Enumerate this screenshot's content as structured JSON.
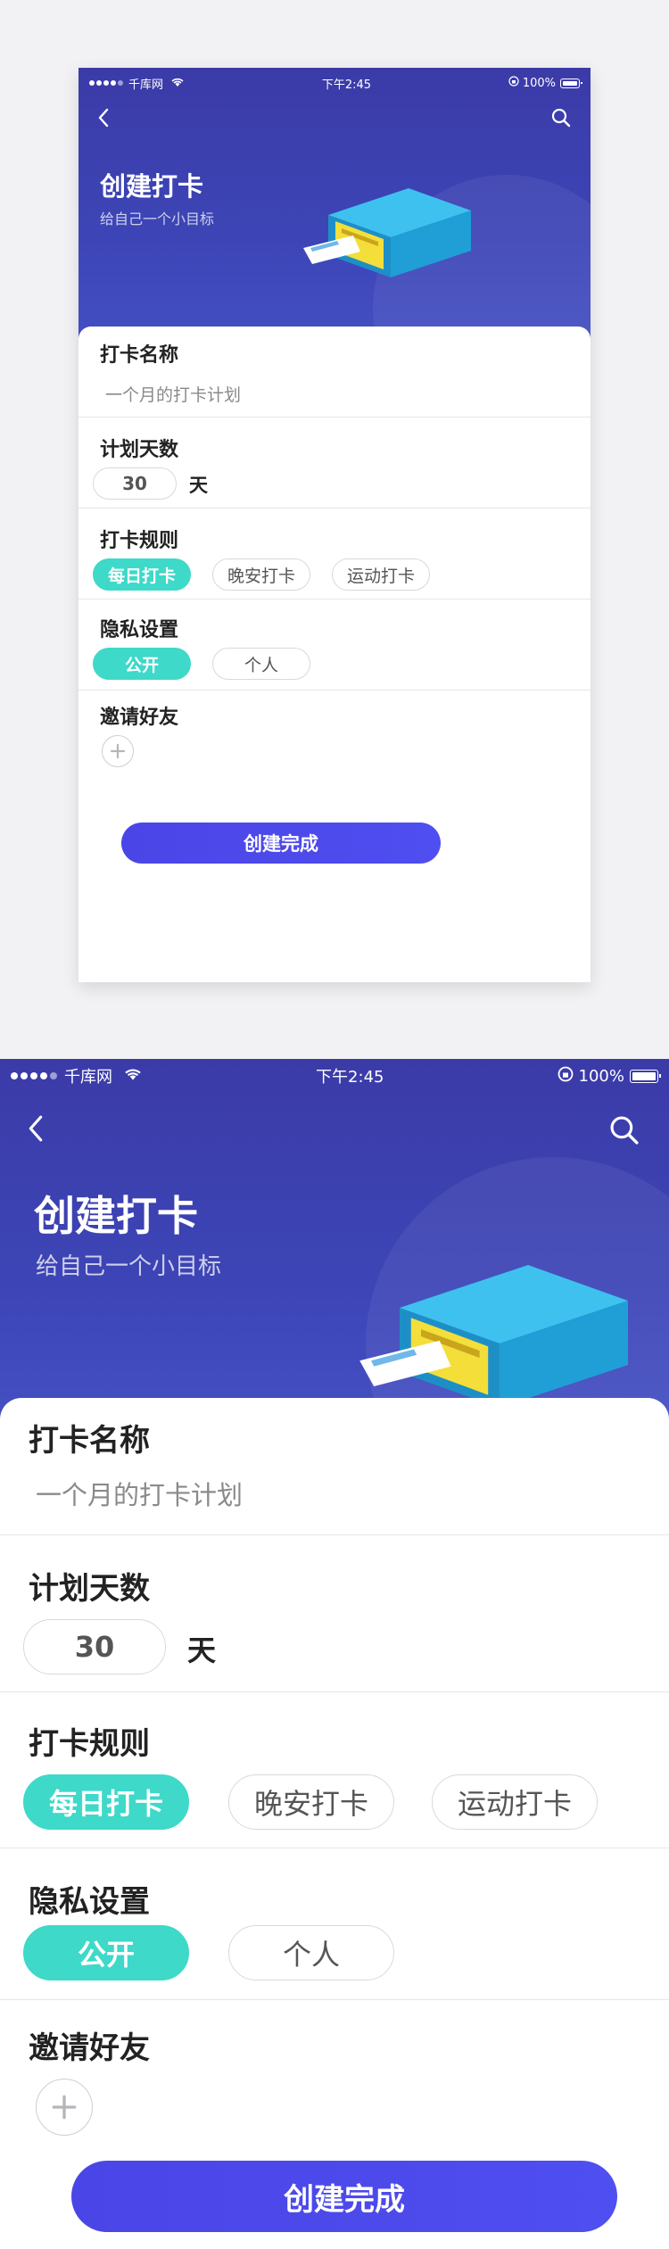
{
  "status_bar": {
    "carrier": "千库网",
    "time": "下午2:45",
    "battery": "100%"
  },
  "header": {
    "title": "创建打卡",
    "subtitle": "给自己一个小目标"
  },
  "icons": {
    "back": "chevron-left-icon",
    "search": "search-icon",
    "add": "plus-icon",
    "wifi": "wifi-icon",
    "battery": "battery-icon",
    "lock": "rotation-lock-icon"
  },
  "colors": {
    "header_bg": "#3d45b6",
    "accent_teal": "#3ed9c8",
    "primary_button": "#4a45e6",
    "illustration_box": "#1f9fd6",
    "illustration_inner": "#f4de3a"
  },
  "form": {
    "name": {
      "label": "打卡名称",
      "placeholder": "一个月的打卡计划"
    },
    "days": {
      "label": "计划天数",
      "value": "30",
      "unit": "天"
    },
    "rules": {
      "label": "打卡规则",
      "options": [
        "每日打卡",
        "晚安打卡",
        "运动打卡"
      ],
      "selected": "每日打卡"
    },
    "privacy": {
      "label": "隐私设置",
      "options": [
        "公开",
        "个人"
      ],
      "selected": "公开"
    },
    "invite": {
      "label": "邀请好友"
    },
    "submit_label": "创建完成"
  }
}
